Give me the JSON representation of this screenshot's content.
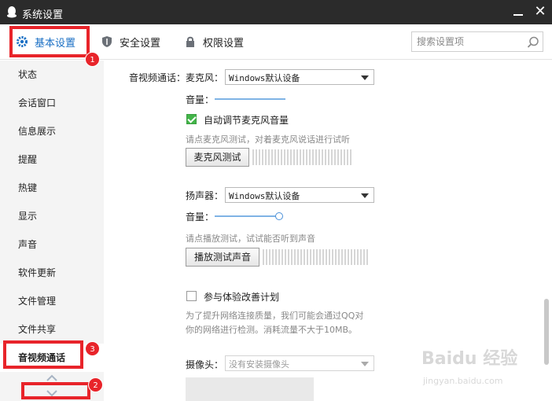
{
  "window": {
    "title": "系统设置"
  },
  "tabs": [
    {
      "label": "基本设置",
      "icon": "gear-icon",
      "active": true
    },
    {
      "label": "安全设置",
      "icon": "shield-icon",
      "active": false
    },
    {
      "label": "权限设置",
      "icon": "lock-icon",
      "active": false
    }
  ],
  "search": {
    "placeholder": "搜索设置项"
  },
  "sidebar": {
    "items": [
      {
        "label": "状态"
      },
      {
        "label": "会话窗口"
      },
      {
        "label": "信息展示"
      },
      {
        "label": "提醒"
      },
      {
        "label": "热键"
      },
      {
        "label": "显示"
      },
      {
        "label": "声音"
      },
      {
        "label": "软件更新"
      },
      {
        "label": "文件管理"
      },
      {
        "label": "文件共享"
      },
      {
        "label": "音视频通话",
        "active": true
      }
    ]
  },
  "annotations": {
    "badge1": "1",
    "badge2": "2",
    "badge3": "3",
    "color": "#e8242a"
  },
  "av": {
    "section_label": "音视频通话：",
    "mic": {
      "label": "麦克风：",
      "device": "Windows默认设备",
      "volume_label": "音量：",
      "auto_adjust_label": "自动调节麦克风音量",
      "auto_adjust_checked": true,
      "hint": "请点麦克风测试，对着麦克风说话进行试听",
      "test_button": "麦克风测试"
    },
    "speaker": {
      "label": "扬声器：",
      "device": "Windows默认设备",
      "volume_label": "音量：",
      "volume_level": 0.95,
      "hint": "请点播放测试，试试能否听到声音",
      "test_button": "播放测试声音"
    },
    "experience": {
      "label": "参与体验改善计划",
      "checked": false,
      "desc_line1": "为了提升网络连接质量，我们可能会通过QQ对",
      "desc_line2": "你的网络进行检测。消耗流量不大于10MB。"
    },
    "camera": {
      "label": "摄像头：",
      "device": "没有安装摄像头"
    }
  },
  "watermark": {
    "line1": "Baidu 经验",
    "line2": "jingyan.baidu.com"
  },
  "colors": {
    "accent": "#1a6fc4",
    "titlebar": "#2b2b2b",
    "check_on": "#42b549"
  }
}
